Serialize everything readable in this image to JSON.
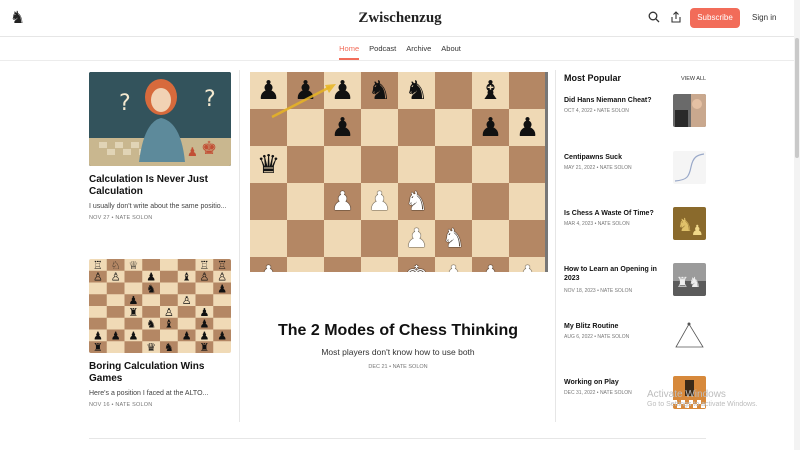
{
  "site": {
    "title": "Zwischenzug",
    "logo_icon": "♞"
  },
  "header": {
    "search_icon": "⌕",
    "share_icon": "⇪",
    "subscribe_label": "Subscribe",
    "signin_label": "Sign in"
  },
  "nav": {
    "items": [
      {
        "label": "Home",
        "active": true
      },
      {
        "label": "Podcast"
      },
      {
        "label": "Archive"
      },
      {
        "label": "About"
      }
    ]
  },
  "left_posts": [
    {
      "title": "Calculation Is Never Just Calculation",
      "excerpt": "I usually don't write about the same positio...",
      "meta": "NOV 27 • NATE SOLON"
    },
    {
      "title": "Boring Calculation Wins Games",
      "excerpt": "Here's a position I faced at the ALTO...",
      "meta": "NOV 16 • NATE SOLON"
    }
  ],
  "hero": {
    "title": "The 2 Modes of Chess Thinking",
    "subtitle": "Most players don't know how to use both",
    "meta": "DEC 21 • NATE SOLON"
  },
  "sidebar": {
    "title": "Most Popular",
    "view_all": "VIEW ALL",
    "items": [
      {
        "title": "Did Hans Niemann Cheat?",
        "meta": "OCT 4, 2022 • NATE SOLON"
      },
      {
        "title": "Centipawns Suck",
        "meta": "MAY 21, 2022 • NATE SOLON"
      },
      {
        "title": "Is Chess A Waste Of Time?",
        "meta": "MAR 4, 2023 • NATE SOLON"
      },
      {
        "title": "How to Learn an Opening in 2023",
        "meta": "NOV 18, 2023 • NATE SOLON"
      },
      {
        "title": "My Blitz Routine",
        "meta": "AUG 6, 2022 • NATE SOLON"
      },
      {
        "title": "Working on Play",
        "meta": "DEC 31, 2022 • NATE SOLON"
      }
    ]
  },
  "os_watermark": {
    "line1": "Activate Windows",
    "line2": "Go to Settings to activate Windows."
  },
  "colors": {
    "accent": "#f26c59",
    "board_light": "#efd9b5",
    "board_dark": "#b48764"
  }
}
